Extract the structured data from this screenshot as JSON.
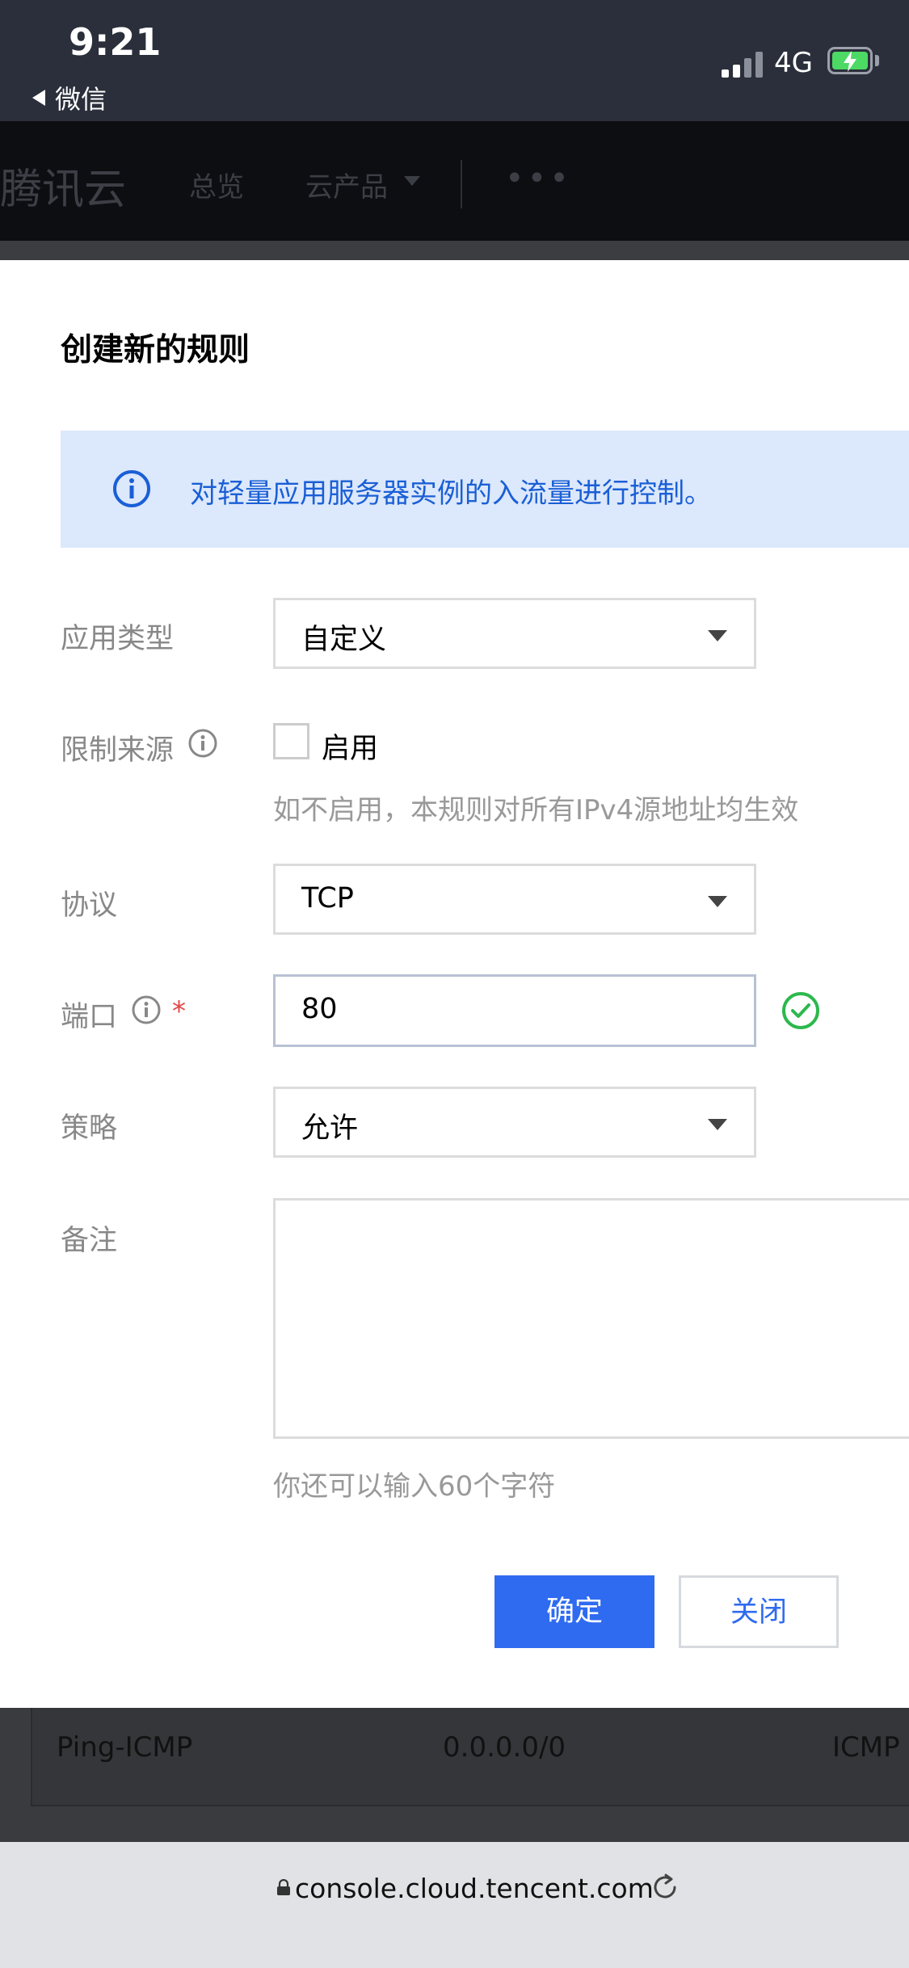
{
  "status_bar": {
    "time": "9:21",
    "back_app": "微信",
    "network": "4G"
  },
  "console_nav": {
    "brand": "腾讯云",
    "overview": "总览",
    "products": "云产品",
    "more": "•••"
  },
  "modal": {
    "title": "创建新的规则",
    "notice": "对轻量应用服务器实例的入流量进行控制。",
    "fields": {
      "app_type": {
        "label": "应用类型",
        "value": "自定义"
      },
      "source_limit": {
        "label": "限制来源",
        "checkbox_label": "启用",
        "checked": false,
        "hint": "如不启用，本规则对所有IPv4源地址均生效"
      },
      "protocol": {
        "label": "协议",
        "value": "TCP"
      },
      "port": {
        "label": "端口",
        "required_mark": "*",
        "value": "80"
      },
      "policy": {
        "label": "策略",
        "value": "允许"
      },
      "remark": {
        "label": "备注",
        "value": "",
        "hint": "你还可以输入60个字符"
      }
    },
    "buttons": {
      "confirm": "确定",
      "close": "关闭"
    }
  },
  "background_table": {
    "row": [
      "Ping-ICMP",
      "0.0.0.0/0",
      "ICMP"
    ]
  },
  "browser": {
    "url": "console.cloud.tencent.com"
  },
  "colors": {
    "primary": "#2f6bf0",
    "notice_bg": "#dce8fb",
    "success": "#2db84d",
    "required": "#e54545"
  }
}
